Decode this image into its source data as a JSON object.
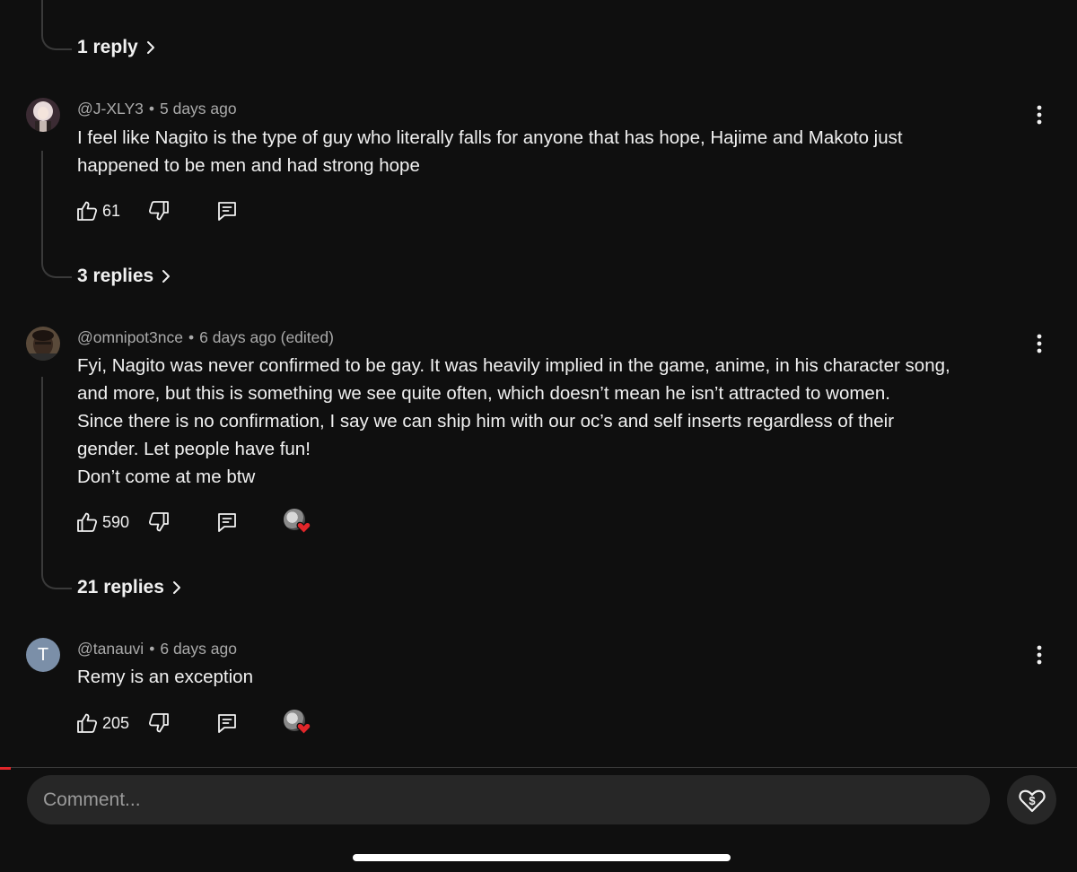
{
  "top_thread": {
    "replies_label": "1 reply"
  },
  "comments": [
    {
      "author": "@J-XLY3",
      "time": "5 days ago",
      "edited": "",
      "text": [
        "I feel like Nagito is the type of guy who literally falls for anyone that has hope, Hajime and Makoto just",
        "happened to be men and had strong hope"
      ],
      "likes": "61",
      "replies_label": "3 replies",
      "creator_heart": false
    },
    {
      "author": "@omnipot3nce",
      "time": "6 days ago",
      "edited": "(edited)",
      "text": [
        "Fyi, Nagito was never confirmed to be gay. It was heavily implied in the game, anime, in his character song,",
        "and more, but this is something we see quite often, which doesn’t mean he isn’t attracted to women.",
        "Since there is no confirmation, I say we can ship him with our oc’s and self inserts regardless of their",
        "gender. Let people have fun!",
        "Don’t come at me btw"
      ],
      "likes": "590",
      "replies_label": "21 replies",
      "creator_heart": true
    },
    {
      "author": "@tanauvi",
      "time": "6 days ago",
      "edited": "",
      "avatar_letter": "T",
      "text": [
        "Remy is an exception"
      ],
      "likes": "205",
      "creator_heart": true
    }
  ],
  "composer": {
    "placeholder": "Comment..."
  },
  "icons": {
    "like": "thumbs-up-icon",
    "dislike": "thumbs-down-icon",
    "reply": "reply-comment-icon",
    "more": "more-vertical-icon",
    "chevron": "chevron-right-icon",
    "thanks": "super-thanks-heart-dollar-icon",
    "heart": "creator-heart-icon"
  },
  "colors": {
    "background": "#0f0f0f",
    "text": "#f1f1f1",
    "meta": "#aaaaaa",
    "heart": "#e1262a",
    "avatar_letter_bg": "#7b8fa8"
  }
}
